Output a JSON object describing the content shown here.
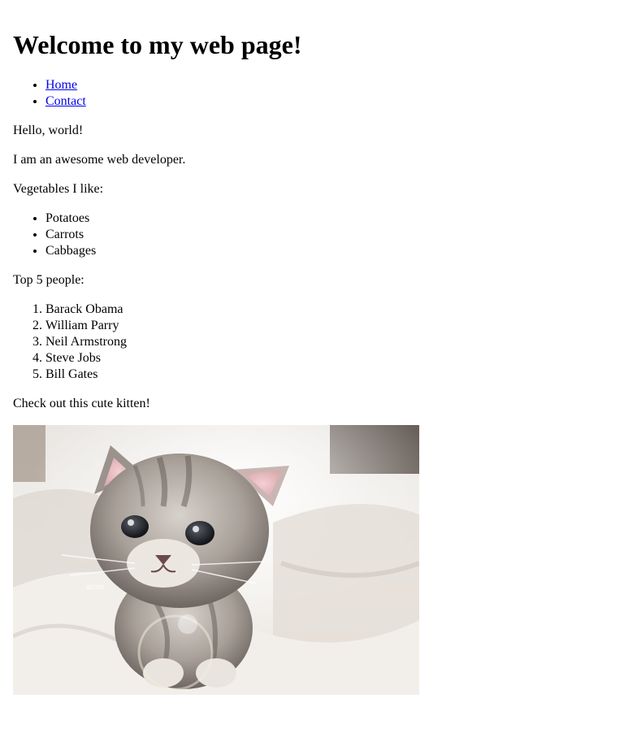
{
  "title": "Welcome to my web page!",
  "nav": [
    {
      "label": "Home"
    },
    {
      "label": "Contact"
    }
  ],
  "greeting": "Hello, world!",
  "intro": "I am an awesome web developer.",
  "vegetables": {
    "heading": "Vegetables I like:",
    "items": [
      "Potatoes",
      "Carrots",
      "Cabbages"
    ]
  },
  "people": {
    "heading": "Top 5 people:",
    "items": [
      "Barack Obama",
      "William Parry",
      "Neil Armstrong",
      "Steve Jobs",
      "Bill Gates"
    ]
  },
  "kitten": {
    "caption": "Check out this cute kitten!",
    "image_subject": "kitten-photo",
    "watermark": "sizzle"
  },
  "colors": {
    "link": "#0000ee",
    "text": "#000000",
    "background": "#ffffff"
  }
}
